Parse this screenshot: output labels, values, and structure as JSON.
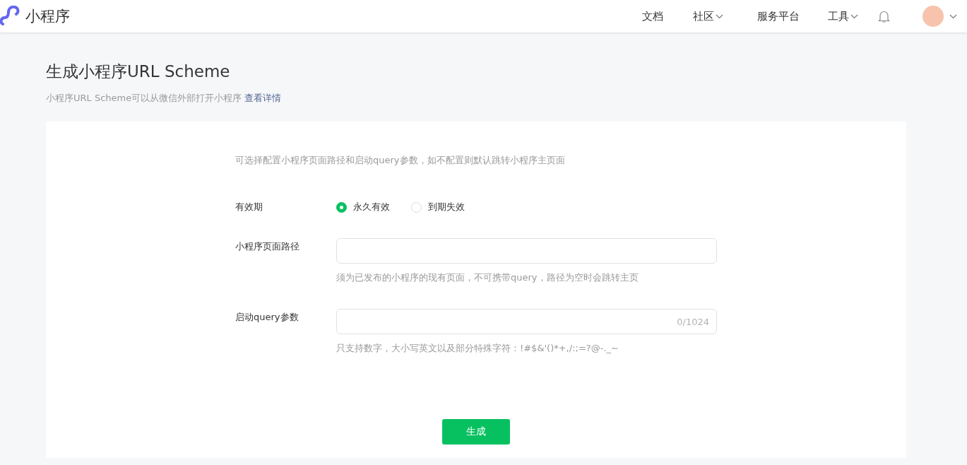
{
  "header": {
    "logo_text": "小程序",
    "nav": [
      {
        "label": "文档",
        "dropdown": false
      },
      {
        "label": "社区",
        "dropdown": true
      },
      {
        "label": "服务平台",
        "dropdown": false
      },
      {
        "label": "工具",
        "dropdown": true
      }
    ]
  },
  "page": {
    "title": "生成小程序URL Scheme",
    "subtitle": "小程序URL Scheme可以从微信外部打开小程序",
    "subtitle_link": "查看详情"
  },
  "form": {
    "intro": "可选择配置小程序页面路径和启动query参数，如不配置则默认跳转小程序主页面",
    "validity": {
      "label": "有效期",
      "options": [
        {
          "label": "永久有效",
          "selected": true
        },
        {
          "label": "到期失效",
          "selected": false
        }
      ]
    },
    "fields": [
      {
        "label": "小程序页面路径",
        "hint": "须为已发布的小程序的现有页面，不可携带query，路径为空时会跳转主页"
      },
      {
        "label": "启动query参数",
        "counter": "0/1024",
        "hint": "只支持数字，大小写英文以及部分特殊字符：!#$&'()*+,/:;=?@-._~"
      }
    ],
    "submit": "生成"
  }
}
